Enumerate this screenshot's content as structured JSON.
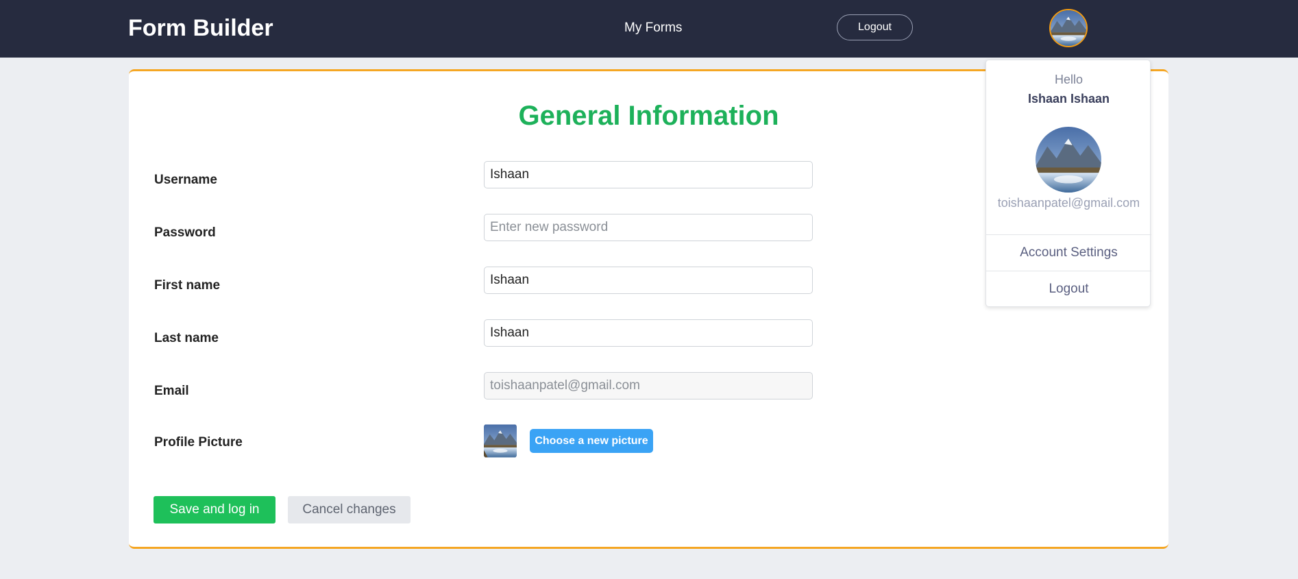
{
  "navbar": {
    "brand": "Form Builder",
    "my_forms": "My Forms",
    "logout": "Logout",
    "avatar_icon": "profile-avatar-icon"
  },
  "form": {
    "title": "General Information",
    "fields": {
      "username": {
        "label": "Username",
        "value": "Ishaan",
        "placeholder": ""
      },
      "password": {
        "label": "Password",
        "value": "",
        "placeholder": "Enter new password"
      },
      "first_name": {
        "label": "First name",
        "value": "Ishaan",
        "placeholder": ""
      },
      "last_name": {
        "label": "Last name",
        "value": "Ishaan",
        "placeholder": ""
      },
      "email": {
        "label": "Email",
        "value": "toishaanpatel@gmail.com",
        "placeholder": "",
        "disabled": true
      }
    },
    "profile_picture": {
      "label": "Profile Picture",
      "button": "Choose a new picture"
    },
    "save": "Save and log in",
    "cancel": "Cancel changes"
  },
  "dropdown": {
    "hello": "Hello",
    "name": "Ishaan Ishaan",
    "email": "toishaanpatel@gmail.com",
    "items": [
      {
        "label": "Account Settings"
      },
      {
        "label": "Logout"
      }
    ]
  },
  "colors": {
    "navbar_bg": "#262b3f",
    "title_green": "#1db15a",
    "accent_orange": "#f5a623",
    "save_green": "#1ec05a",
    "choose_blue": "#3aa3f5"
  }
}
